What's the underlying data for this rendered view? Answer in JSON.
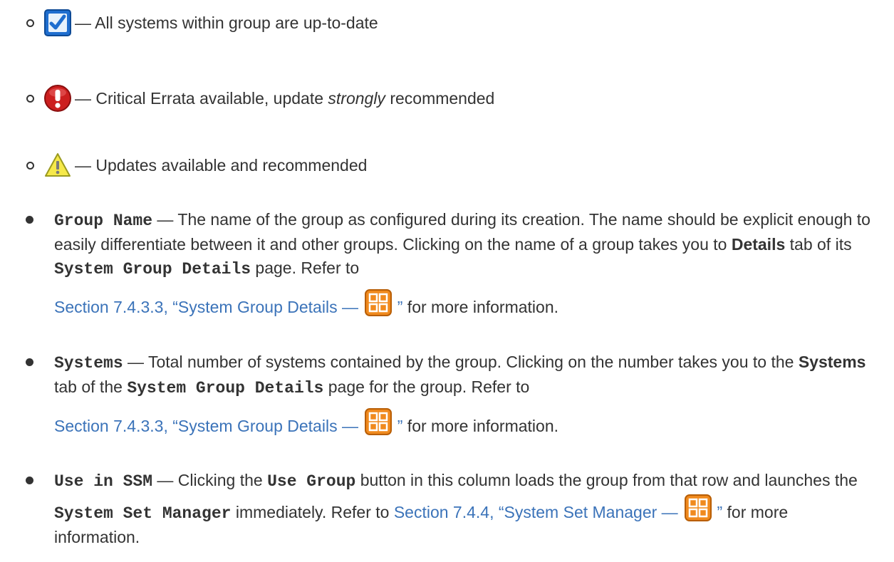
{
  "status_items": [
    {
      "icon": "checkbox-checked-icon",
      "text": "— All systems within group are up-to-date"
    },
    {
      "icon": "critical-error-icon",
      "text_before": "— Critical Errata available, update ",
      "emphasis": "strongly",
      "text_after": " recommended"
    },
    {
      "icon": "warning-icon",
      "text": "— Updates available and recommended"
    }
  ],
  "items": [
    {
      "term": "Group Name",
      "t1": " — The name of the group as configured during its creation. The name should be explicit enough to easily differentiate between it and other groups. Clicking on the name of a group takes you to ",
      "b1": "Details",
      "t2": " tab of its ",
      "b2": "System Group Details",
      "t3": " page. Refer to",
      "link": "Section 7.4.3.3, “System Group Details — ",
      "link_close": "”",
      "tail": " for more information."
    },
    {
      "term": "Systems",
      "t1": " — Total number of systems contained by the group. Clicking on the number takes you to the ",
      "b1": "Systems",
      "t2": " tab of the ",
      "b2": "System Group Details",
      "t3": " page for the group. Refer to",
      "link": "Section 7.4.3.3, “System Group Details — ",
      "link_close": "”",
      "tail": " for more information."
    },
    {
      "term": "Use in SSM",
      "t1": " — Clicking the ",
      "b1": "Use Group",
      "t2": " button in this column loads the group from that row and launches the ",
      "b2": "System Set Manager",
      "t3": " immediately. Refer to ",
      "link": "Section 7.4.4, “System Set Manager — ",
      "link_close": "”",
      "tail": " for more information."
    }
  ],
  "colors": {
    "text": "#333333",
    "link": "#3b73b9",
    "menu_icon": "#f08a1e"
  }
}
